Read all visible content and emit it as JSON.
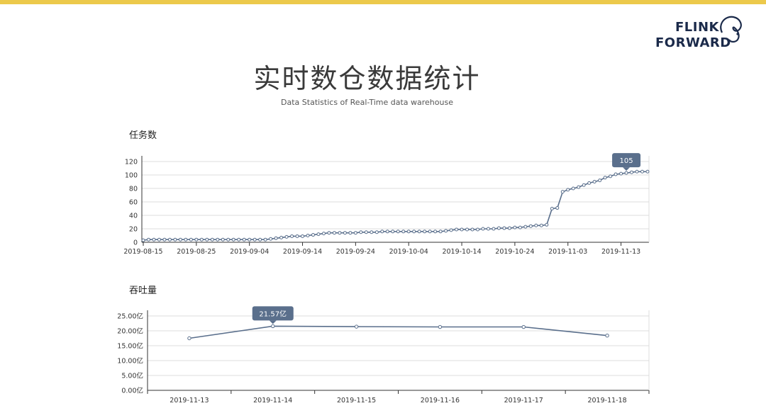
{
  "slide": {
    "title": "实时数仓数据统计",
    "subtitle": "Data Statistics of Real-Time data warehouse",
    "accent_color": "#ecc94b"
  },
  "logo": {
    "line1": "FLINK",
    "line2": "FORWARD",
    "icon": "squirrel-icon"
  },
  "chart_data": [
    {
      "type": "line",
      "title": "任务数",
      "x": [
        "2019-08-15",
        "2019-08-16",
        "2019-08-17",
        "2019-08-18",
        "2019-08-19",
        "2019-08-20",
        "2019-08-21",
        "2019-08-22",
        "2019-08-23",
        "2019-08-24",
        "2019-08-25",
        "2019-08-26",
        "2019-08-27",
        "2019-08-28",
        "2019-08-29",
        "2019-08-30",
        "2019-08-31",
        "2019-09-01",
        "2019-09-02",
        "2019-09-03",
        "2019-09-04",
        "2019-09-05",
        "2019-09-06",
        "2019-09-07",
        "2019-09-08",
        "2019-09-09",
        "2019-09-10",
        "2019-09-11",
        "2019-09-12",
        "2019-09-13",
        "2019-09-14",
        "2019-09-15",
        "2019-09-16",
        "2019-09-17",
        "2019-09-18",
        "2019-09-19",
        "2019-09-20",
        "2019-09-21",
        "2019-09-22",
        "2019-09-23",
        "2019-09-24",
        "2019-09-25",
        "2019-09-26",
        "2019-09-27",
        "2019-09-28",
        "2019-09-29",
        "2019-09-30",
        "2019-10-01",
        "2019-10-02",
        "2019-10-03",
        "2019-10-04",
        "2019-10-05",
        "2019-10-06",
        "2019-10-07",
        "2019-10-08",
        "2019-10-09",
        "2019-10-10",
        "2019-10-11",
        "2019-10-12",
        "2019-10-13",
        "2019-10-14",
        "2019-10-15",
        "2019-10-16",
        "2019-10-17",
        "2019-10-18",
        "2019-10-19",
        "2019-10-20",
        "2019-10-21",
        "2019-10-22",
        "2019-10-23",
        "2019-10-24",
        "2019-10-25",
        "2019-10-26",
        "2019-10-27",
        "2019-10-28",
        "2019-10-29",
        "2019-10-30",
        "2019-10-31",
        "2019-11-01",
        "2019-11-02",
        "2019-11-03",
        "2019-11-04",
        "2019-11-05",
        "2019-11-06",
        "2019-11-07",
        "2019-11-08",
        "2019-11-09",
        "2019-11-10",
        "2019-11-11",
        "2019-11-12",
        "2019-11-13",
        "2019-11-14",
        "2019-11-15",
        "2019-11-16",
        "2019-11-17",
        "2019-11-18"
      ],
      "values": [
        3,
        4,
        4,
        4,
        4,
        4,
        4,
        4,
        4,
        4,
        4,
        4,
        4,
        4,
        4,
        4,
        4,
        4,
        4,
        4,
        4,
        4,
        4,
        4,
        5,
        6,
        7,
        8,
        9,
        9,
        9,
        10,
        11,
        12,
        13,
        14,
        14,
        14,
        14,
        14,
        14,
        15,
        15,
        15,
        15,
        16,
        16,
        16,
        16,
        16,
        16,
        16,
        16,
        16,
        16,
        16,
        16,
        17,
        18,
        19,
        19,
        19,
        19,
        19,
        20,
        20,
        20,
        21,
        21,
        21,
        22,
        22,
        23,
        24,
        25,
        25,
        26,
        50,
        51,
        75,
        78,
        80,
        82,
        85,
        88,
        90,
        92,
        96,
        98,
        101,
        102,
        103,
        104,
        105,
        105,
        105
      ],
      "x_ticks": [
        "2019-08-15",
        "2019-08-25",
        "2019-09-04",
        "2019-09-14",
        "2019-09-24",
        "2019-10-04",
        "2019-10-14",
        "2019-10-24",
        "2019-11-03",
        "2019-11-13"
      ],
      "y_ticks": [
        "0",
        "20",
        "40",
        "60",
        "80",
        "100",
        "120"
      ],
      "ylim": [
        0,
        120
      ],
      "grid": true,
      "annotation": {
        "x": "2019-11-14",
        "label": "105"
      },
      "line_color": "#5a6f8c"
    },
    {
      "type": "line",
      "title": "吞吐量",
      "x": [
        "2019-11-13",
        "2019-11-14",
        "2019-11-15",
        "2019-11-16",
        "2019-11-17",
        "2019-11-18"
      ],
      "values": [
        17.5,
        21.57,
        21.4,
        21.3,
        21.3,
        18.4
      ],
      "y_ticks": [
        "0.00亿",
        "5.00亿",
        "10.00亿",
        "15.00亿",
        "20.00亿",
        "25.00亿"
      ],
      "ylim": [
        0,
        25
      ],
      "grid": true,
      "annotation": {
        "x": "2019-11-14",
        "label": "21.57亿"
      },
      "line_color": "#5a6f8c"
    }
  ]
}
